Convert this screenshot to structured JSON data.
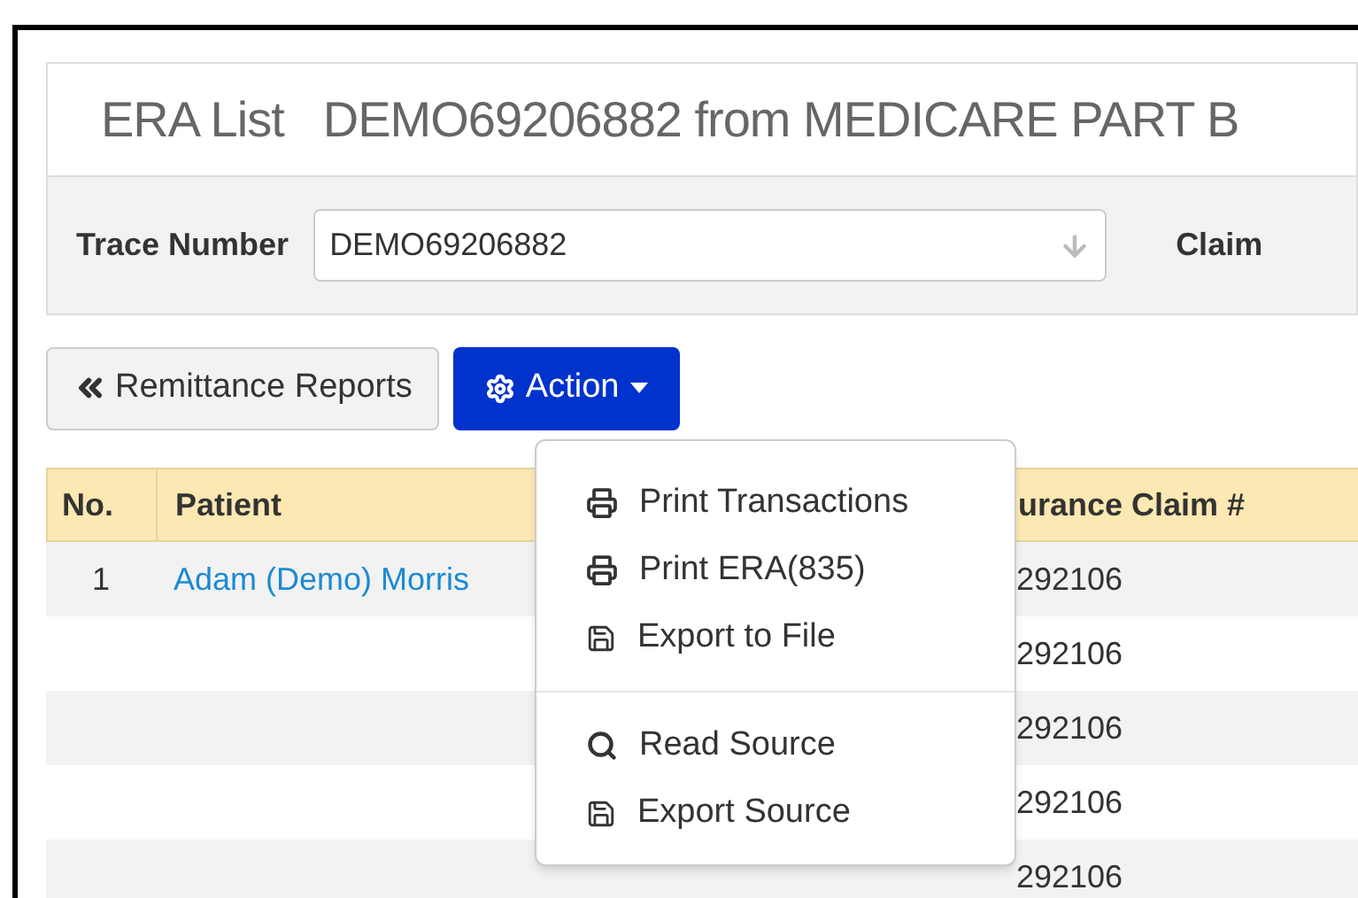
{
  "header": {
    "title": "ERA List",
    "subtitle": "DEMO69206882 from MEDICARE PART B"
  },
  "filters": {
    "trace_label": "Trace Number",
    "trace_value": "DEMO69206882",
    "claim_label": "Claim"
  },
  "buttons": [
    {
      "kind": "back",
      "label": "Remittance Reports"
    },
    {
      "kind": "action",
      "label": "Action",
      "expanded": true
    }
  ],
  "table": {
    "columns": [
      "No.",
      "Patient",
      "urance Claim #"
    ],
    "rows": [
      {
        "no": "1",
        "patient": "Adam (Demo) Morris",
        "claim": "292106"
      },
      {
        "no": "",
        "patient": "",
        "claim": "292106"
      },
      {
        "no": "",
        "patient": "",
        "claim": "292106"
      },
      {
        "no": "",
        "patient": "",
        "claim": "292106"
      },
      {
        "no": "",
        "patient": "",
        "claim": "292106"
      }
    ]
  },
  "menu": {
    "groups": [
      [
        {
          "kind": "print",
          "label": "Print Transactions"
        },
        {
          "kind": "print",
          "label": "Print ERA(835)"
        },
        {
          "kind": "save",
          "label": "Export to File"
        }
      ],
      [
        {
          "kind": "search",
          "label": "Read Source"
        },
        {
          "kind": "save",
          "label": "Export Source"
        }
      ]
    ]
  }
}
